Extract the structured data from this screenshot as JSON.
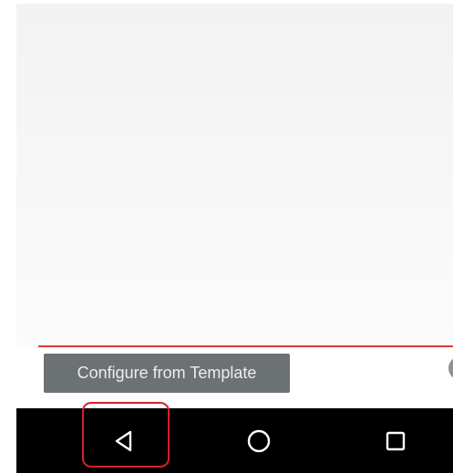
{
  "screen": {
    "tooltip_text": "Configure from Template"
  },
  "navigation_bar": {
    "keys": [
      {
        "name": "back",
        "icon": "back-triangle-icon"
      },
      {
        "name": "home",
        "icon": "home-circle-icon"
      },
      {
        "name": "recents",
        "icon": "recents-square-icon"
      }
    ]
  },
  "colors": {
    "accent_line": "#d83a3a",
    "highlight_outline": "#d6202a",
    "tooltip_background": "#6c7173",
    "nav_bar_background": "#000000"
  }
}
